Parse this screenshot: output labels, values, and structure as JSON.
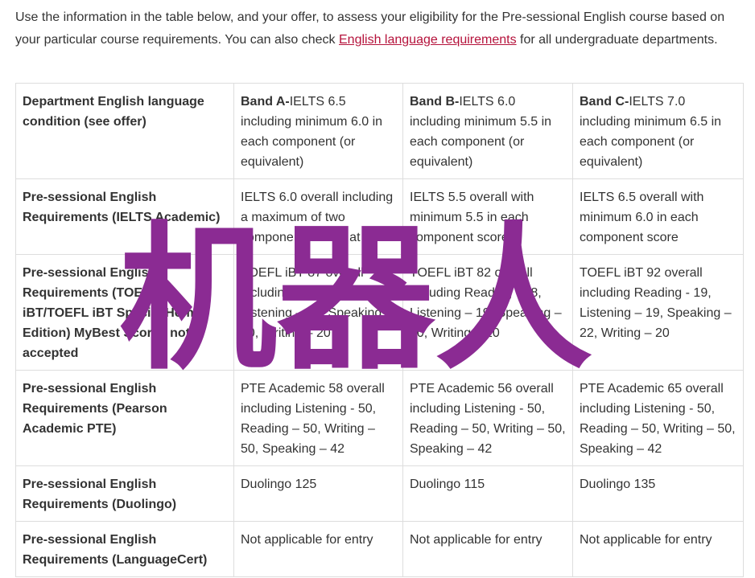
{
  "intro": {
    "text_before": "Use the information in the table below, and your offer, to assess your eligibility for the Pre-sessional English course based on your particular course requirements. You can also check ",
    "link": "English language requirements",
    "text_after": " for all undergraduate departments."
  },
  "table": {
    "header": {
      "label": "Department English language condition (see offer)",
      "bands": [
        {
          "name": "Band A-",
          "detail": "IELTS 6.5 including minimum 6.0 in each component (or equivalent)"
        },
        {
          "name": "Band B-",
          "detail": "IELTS 6.0 including minimum 5.5 in each component (or equivalent)"
        },
        {
          "name": "Band C-",
          "detail": "IELTS 7.0 including minimum 6.5 in each component (or equivalent)"
        }
      ]
    },
    "rows": [
      {
        "label": "Pre-sessional English Requirements (IELTS Academic)",
        "cells": [
          "IELTS 6.0 overall including a maximum of two component scores at 5.5",
          "IELTS 5.5 overall with minimum 5.5 in each component score",
          "IELTS 6.5 overall with minimum 6.0 in each component score"
        ]
      },
      {
        "label": "Pre-sessional English Requirements (TOEFL iBT/TOEFL iBT Special Home Edition) MyBest Scores not accepted",
        "cells": [
          "TOEFL iBT 87 overall including Reading - 18, Listening – 17, Speaking – 20, Writing – 20",
          "TOEFL iBT 82 overall including Reading - 18, Listening – 19, Speaking – 20, Writing – 20",
          "TOEFL iBT 92 overall including Reading - 19, Listening – 19, Speaking – 22, Writing – 20"
        ]
      },
      {
        "label": "Pre-sessional English Requirements (Pearson Academic PTE)",
        "cells": [
          "PTE Academic 58 overall including Listening - 50, Reading – 50, Writing – 50, Speaking – 42",
          "PTE Academic 56 overall including Listening - 50, Reading – 50, Writing – 50, Speaking – 42",
          "PTE Academic 65 overall including Listening - 50, Reading – 50, Writing – 50, Speaking – 42"
        ]
      },
      {
        "label": "Pre-sessional English Requirements (Duolingo)",
        "cells": [
          "Duolingo 125",
          "Duolingo 115",
          "Duolingo 135"
        ]
      },
      {
        "label": "Pre-sessional English Requirements (LanguageCert)",
        "cells": [
          "Not applicable for entry",
          "Not applicable for entry",
          "Not applicable for entry"
        ]
      }
    ]
  },
  "watermark": {
    "text": "机器人",
    "color": "#8b2b93"
  },
  "colors": {
    "link": "#b5123b",
    "border": "#dddddd",
    "text": "#333333"
  }
}
